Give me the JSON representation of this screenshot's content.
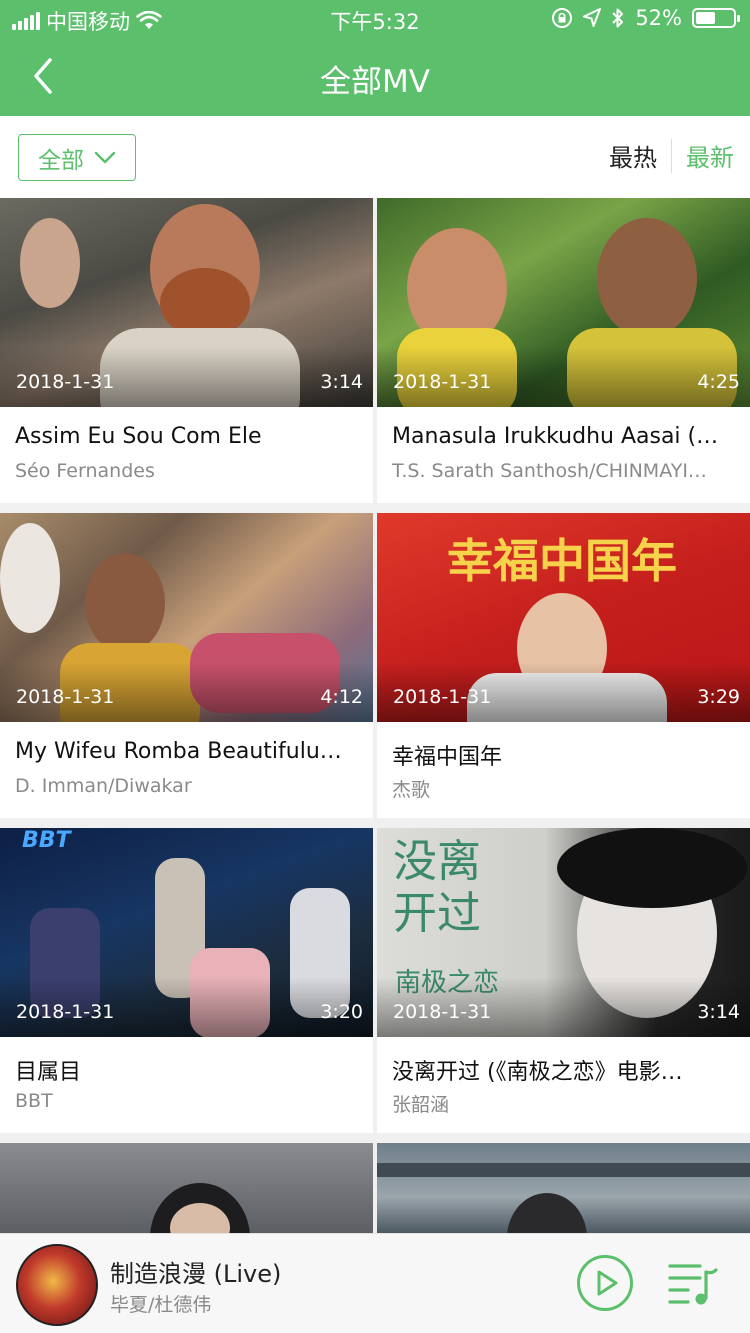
{
  "status_bar": {
    "carrier": "中国移动",
    "time": "下午5:32",
    "battery_percent": "52%",
    "battery_level": 0.52,
    "icons": [
      "signal-icon",
      "wifi-icon",
      "orientation-lock-icon",
      "location-icon",
      "bluetooth-icon",
      "battery-icon"
    ]
  },
  "header": {
    "title": "全部MV",
    "back_icon": "chevron-left-icon"
  },
  "filter": {
    "dropdown_label": "全部",
    "sort_hot": "最热",
    "sort_new": "最新",
    "active_sort": "最新"
  },
  "videos": [
    {
      "date": "2018-1-31",
      "duration": "3:14",
      "title": "Assim Eu Sou Com Ele",
      "artist": "Séo Fernandes"
    },
    {
      "date": "2018-1-31",
      "duration": "4:25",
      "title": "Manasula Irukkudhu Aasai (…",
      "artist": "T.S. Sarath Santhosh/CHINMAYI…"
    },
    {
      "date": "2018-1-31",
      "duration": "4:12",
      "title": "My Wifeu Romba Beautifulu…",
      "artist": "D. Imman/Diwakar"
    },
    {
      "date": "2018-1-31",
      "duration": "3:29",
      "title": "幸福中国年",
      "artist": "杰歌"
    },
    {
      "date": "2018-1-31",
      "duration": "3:20",
      "title": "目属目",
      "artist": "BBT"
    },
    {
      "date": "2018-1-31",
      "duration": "3:14",
      "title": "没离开过 (《南极之恋》电影…",
      "artist": "张韶涵"
    }
  ],
  "thumb_text": {
    "card4": "幸福中国年",
    "card5": "BBT",
    "card6_main": "没离开过",
    "card6_sub": "南极之恋"
  },
  "player": {
    "title": "制造浪漫 (Live)",
    "artist": "毕夏/杜德伟",
    "play_icon": "play-circle-icon",
    "playlist_icon": "playlist-icon"
  },
  "colors": {
    "accent": "#5cbf6c",
    "text_primary": "#111111",
    "text_secondary": "#8a8a8a"
  }
}
